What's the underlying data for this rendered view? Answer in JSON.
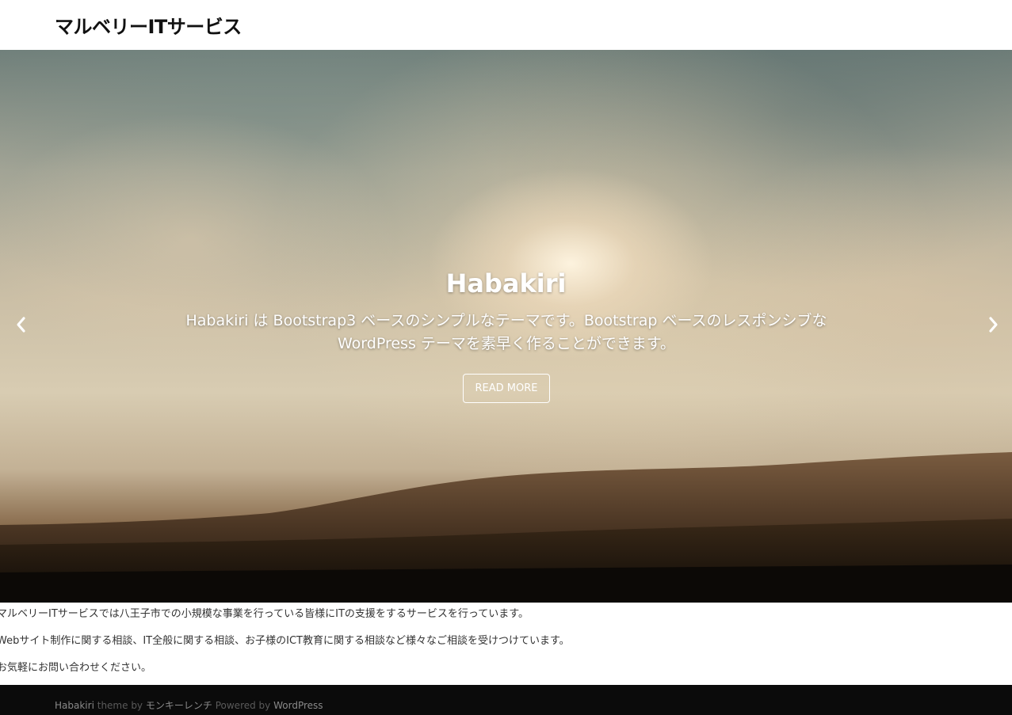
{
  "header": {
    "site_title": "マルベリーITサービス"
  },
  "slider": {
    "title": "Habakiri",
    "text": "Habakiri は Bootstrap3 ベースのシンプルなテーマです。Bootstrap ベースのレスポンシブな WordPress テーマを素早く作ることができます。",
    "button_label": "READ MORE",
    "prev_icon": "chevron-left-icon",
    "next_icon": "chevron-right-icon"
  },
  "content": {
    "paragraphs": [
      "マルベリーITサービスでは八王子市での小規模な事業を行っている皆様にITの支援をするサービスを行っています。",
      "Webサイト制作に関する相談、IT全般に関する相談、お子様のICT教育に関する相談など様々なご相談を受けつけています。",
      "お気軽にお問い合わせください。"
    ]
  },
  "footer": {
    "theme_name": "Habakiri",
    "theme_by": "theme by",
    "author": "モンキーレンチ",
    "powered_by": "Powered by",
    "wordpress": "WordPress"
  },
  "colors": {
    "footer_bg": "#0b0b0b",
    "header_bg": "#ffffff",
    "caption_text": "#ffffff"
  }
}
